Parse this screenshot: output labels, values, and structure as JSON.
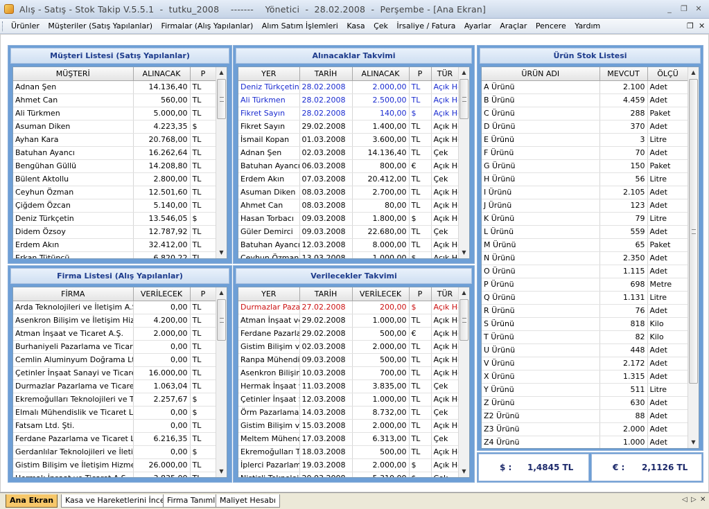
{
  "window": {
    "title": "Alış - Satış - Stok Takip V.5.5.1  -  tutku_2008    -------    Yönetici  -  28.02.2008  -  Perşembe - [Ana Ekran]",
    "minimize": "_",
    "restore": "❐",
    "close": "✕"
  },
  "menu": [
    "Ürünler",
    "Müşteriler (Satış Yapılanlar)",
    "Firmalar (Alış Yapılanlar)",
    "Alım Satım İşlemleri",
    "Kasa",
    "Çek",
    "İrsaliye / Fatura",
    "Ayarlar",
    "Araçlar",
    "Pencere",
    "Yardım"
  ],
  "mdi": {
    "restore": "❐",
    "close": "✕"
  },
  "customers": {
    "title": "Müşteri Listesi (Satış Yapılanlar)",
    "columns": [
      "MÜŞTERİ",
      "ALINACAK",
      "P"
    ],
    "rows": [
      [
        "Adnan Şen",
        "14.136,40",
        "TL"
      ],
      [
        "Ahmet Can",
        "560,00",
        "TL"
      ],
      [
        "Ali Türkmen",
        "5.000,00",
        "TL"
      ],
      [
        "Asuman Diken",
        "4.223,35",
        "$"
      ],
      [
        "Ayhan Kara",
        "20.768,00",
        "TL"
      ],
      [
        "Batuhan Ayancı",
        "16.262,64",
        "TL"
      ],
      [
        "Bengühan Güllü",
        "14.208,80",
        "TL"
      ],
      [
        "Bülent Aktollu",
        "2.800,00",
        "TL"
      ],
      [
        "Ceyhun Özman",
        "12.501,60",
        "TL"
      ],
      [
        "Çiğdem Özcan",
        "5.140,00",
        "TL"
      ],
      [
        "Deniz Türkçetin",
        "13.546,05",
        "$"
      ],
      [
        "Didem Özsoy",
        "12.787,92",
        "TL"
      ],
      [
        "Erdem Akın",
        "32.412,00",
        "TL"
      ],
      [
        "Erkan Tütüncü",
        "6.820,22",
        "TL"
      ]
    ]
  },
  "receivables": {
    "title": "Alınacaklar Takvimi",
    "columns": [
      "YER",
      "TARİH",
      "ALINACAK",
      "P",
      "TÜR"
    ],
    "rows": [
      [
        "Deniz Türkçetin",
        "28.02.2008",
        "2.000,00",
        "TL",
        "Açık He"
      ],
      [
        "Ali Türkmen",
        "28.02.2008",
        "2.500,00",
        "TL",
        "Açık He"
      ],
      [
        "Fikret Sayın",
        "28.02.2008",
        "140,00",
        "$",
        "Açık He"
      ],
      [
        "Fikret Sayın",
        "29.02.2008",
        "1.400,00",
        "TL",
        "Açık He"
      ],
      [
        "İsmail Kopan",
        "01.03.2008",
        "3.600,00",
        "TL",
        "Açık He"
      ],
      [
        "Adnan Şen",
        "02.03.2008",
        "14.136,40",
        "TL",
        "Çek"
      ],
      [
        "Batuhan Ayancı",
        "06.03.2008",
        "800,00",
        "€",
        "Açık He"
      ],
      [
        "Erdem Akın",
        "07.03.2008",
        "20.412,00",
        "TL",
        "Çek"
      ],
      [
        "Asuman Diken",
        "08.03.2008",
        "2.700,00",
        "TL",
        "Açık He"
      ],
      [
        "Ahmet Can",
        "08.03.2008",
        "80,00",
        "TL",
        "Açık He"
      ],
      [
        "Hasan Torbacı",
        "09.03.2008",
        "1.800,00",
        "$",
        "Açık He"
      ],
      [
        "Güler Demirci",
        "09.03.2008",
        "22.680,00",
        "TL",
        "Çek"
      ],
      [
        "Batuhan Ayancı",
        "12.03.2008",
        "8.000,00",
        "TL",
        "Açık He"
      ],
      [
        "Ceyhun Özman",
        "13.03.2008",
        "1.000,00",
        "$",
        "Açık He"
      ]
    ],
    "highlight_rows": 3,
    "highlight_color": "#1a2bd0"
  },
  "stock": {
    "title": "Ürün Stok Listesi",
    "columns": [
      "ÜRÜN ADI",
      "MEVCUT",
      "ÖLÇÜ"
    ],
    "rows": [
      [
        "A Ürünü",
        "2.100",
        "Adet"
      ],
      [
        "B Ürünü",
        "4.459",
        "Adet"
      ],
      [
        "C Ürünü",
        "288",
        "Paket"
      ],
      [
        "D Ürünü",
        "370",
        "Adet"
      ],
      [
        "E Ürünü",
        "3",
        "Litre"
      ],
      [
        "F Ürünü",
        "70",
        "Adet"
      ],
      [
        "G Ürünü",
        "150",
        "Paket"
      ],
      [
        "H Ürünü",
        "56",
        "Litre"
      ],
      [
        "I Ürünü",
        "2.105",
        "Adet"
      ],
      [
        "J Ürünü",
        "123",
        "Adet"
      ],
      [
        "K Ürünü",
        "79",
        "Litre"
      ],
      [
        "L Ürünü",
        "559",
        "Adet"
      ],
      [
        "M Ürünü",
        "65",
        "Paket"
      ],
      [
        "N Ürünü",
        "2.350",
        "Adet"
      ],
      [
        "O Ürünü",
        "1.115",
        "Adet"
      ],
      [
        "P Ürünü",
        "698",
        "Metre"
      ],
      [
        "Q Ürünü",
        "1.131",
        "Litre"
      ],
      [
        "R Ürünü",
        "76",
        "Adet"
      ],
      [
        "S Ürünü",
        "818",
        "Kilo"
      ],
      [
        "T Ürünü",
        "82",
        "Kilo"
      ],
      [
        "U Ürünü",
        "448",
        "Adet"
      ],
      [
        "V Ürünü",
        "2.172",
        "Adet"
      ],
      [
        "X Ürünü",
        "1.315",
        "Adet"
      ],
      [
        "Y Ürünü",
        "511",
        "Litre"
      ],
      [
        "Z Ürünü",
        "630",
        "Adet"
      ],
      [
        "Z2 Ürünü",
        "88",
        "Adet"
      ],
      [
        "Z3 Ürünü",
        "2.000",
        "Adet"
      ],
      [
        "Z4 Ürünü",
        "1.000",
        "Adet"
      ]
    ]
  },
  "firms": {
    "title": "Firma Listesi (Alış Yapılanlar)",
    "columns": [
      "FİRMA",
      "VERİLECEK",
      "P"
    ],
    "rows": [
      [
        "Arda Teknolojileri ve İletişim A.Ş.",
        "0,00",
        "TL"
      ],
      [
        "Asenkron Bilişim ve İletişim Hizmetle",
        "4.200,00",
        "TL"
      ],
      [
        "Atman İnşaat ve Ticaret A.Ş.",
        "2.000,00",
        "TL"
      ],
      [
        "Burhaniyeli Pazarlama ve Ticaret Ltd",
        "0,00",
        "TL"
      ],
      [
        "Cemlin Aluminyum Doğrama Ltd.Şti.",
        "0,00",
        "TL"
      ],
      [
        "Çetinler İnşaat Sanayi ve Ticaret A.Ş",
        "16.000,00",
        "TL"
      ],
      [
        "Durmazlar Pazarlama ve Ticaret Ltd",
        "1.063,04",
        "TL"
      ],
      [
        "Ekremoğulları Teknolojileri ve Ticaret",
        "2.257,67",
        "$"
      ],
      [
        "Elmalı Mühendislik ve Ticaret Ltd. Ş",
        "0,00",
        "$"
      ],
      [
        "Fatsam Ltd. Şti.",
        "0,00",
        "TL"
      ],
      [
        "Ferdane Pazarlama ve Ticaret Ltd.Ş",
        "6.216,35",
        "TL"
      ],
      [
        "Gerdanlılar Teknolojileri ve İletişim A",
        "0,00",
        "$"
      ],
      [
        "Gistim Bilişim ve İletişim Hizmetleri",
        "26.000,00",
        "TL"
      ],
      [
        "Hermak İnşaat ve Ticaret A.Ş.",
        "3.835,00",
        "TL"
      ]
    ]
  },
  "payables": {
    "title": "Verilecekler Takvimi",
    "columns": [
      "YER",
      "TARİH",
      "VERİLECEK",
      "P",
      "TÜR"
    ],
    "rows": [
      [
        "Durmazlar Pazarla",
        "27.02.2008",
        "200,00",
        "$",
        "Açık He"
      ],
      [
        "Atman İnşaat ve T",
        "29.02.2008",
        "1.000,00",
        "TL",
        "Açık He"
      ],
      [
        "Ferdane Pazarlam",
        "29.02.2008",
        "500,00",
        "€",
        "Açık He"
      ],
      [
        "Gistim Bilişim ve İl",
        "02.03.2008",
        "2.000,00",
        "TL",
        "Açık He"
      ],
      [
        "Ranpa Mühendis",
        "09.03.2008",
        "500,00",
        "TL",
        "Açık He"
      ],
      [
        "Asenkron Bilişim v",
        "10.03.2008",
        "700,00",
        "TL",
        "Açık He"
      ],
      [
        "Hermak İnşaat ve",
        "11.03.2008",
        "3.835,00",
        "TL",
        "Çek"
      ],
      [
        "Çetinler İnşaat Sa",
        "12.03.2008",
        "1.000,00",
        "TL",
        "Açık He"
      ],
      [
        "Örm Pazarlama ve",
        "14.03.2008",
        "8.732,00",
        "TL",
        "Çek"
      ],
      [
        "Gistim Bilişim ve İl",
        "15.03.2008",
        "2.000,00",
        "TL",
        "Açık He"
      ],
      [
        "Meltem Mühendis",
        "17.03.2008",
        "6.313,00",
        "TL",
        "Çek"
      ],
      [
        "Ekremoğulları Tel",
        "18.03.2008",
        "500,00",
        "TL",
        "Açık He"
      ],
      [
        "İplerci Pazarlama",
        "19.03.2008",
        "2.000,00",
        "$",
        "Açık He"
      ],
      [
        "Nistisli Teknolojile",
        "20.03.2008",
        "5.310,00",
        "$",
        "Çek"
      ]
    ],
    "highlight_rows": 1,
    "highlight_color": "#cc1111"
  },
  "rates": {
    "usd_label": "$ :",
    "usd_value": "1,4845 TL",
    "eur_label": "€ :",
    "eur_value": "2,1126 TL"
  },
  "tabs": [
    "Ana Ekran",
    "Kasa ve Hareketlerini İncele",
    "Firma Tanımla",
    "Maliyet Hesabı"
  ],
  "tabnav": {
    "prev": "◁",
    "next": "▷",
    "close": "✕"
  }
}
